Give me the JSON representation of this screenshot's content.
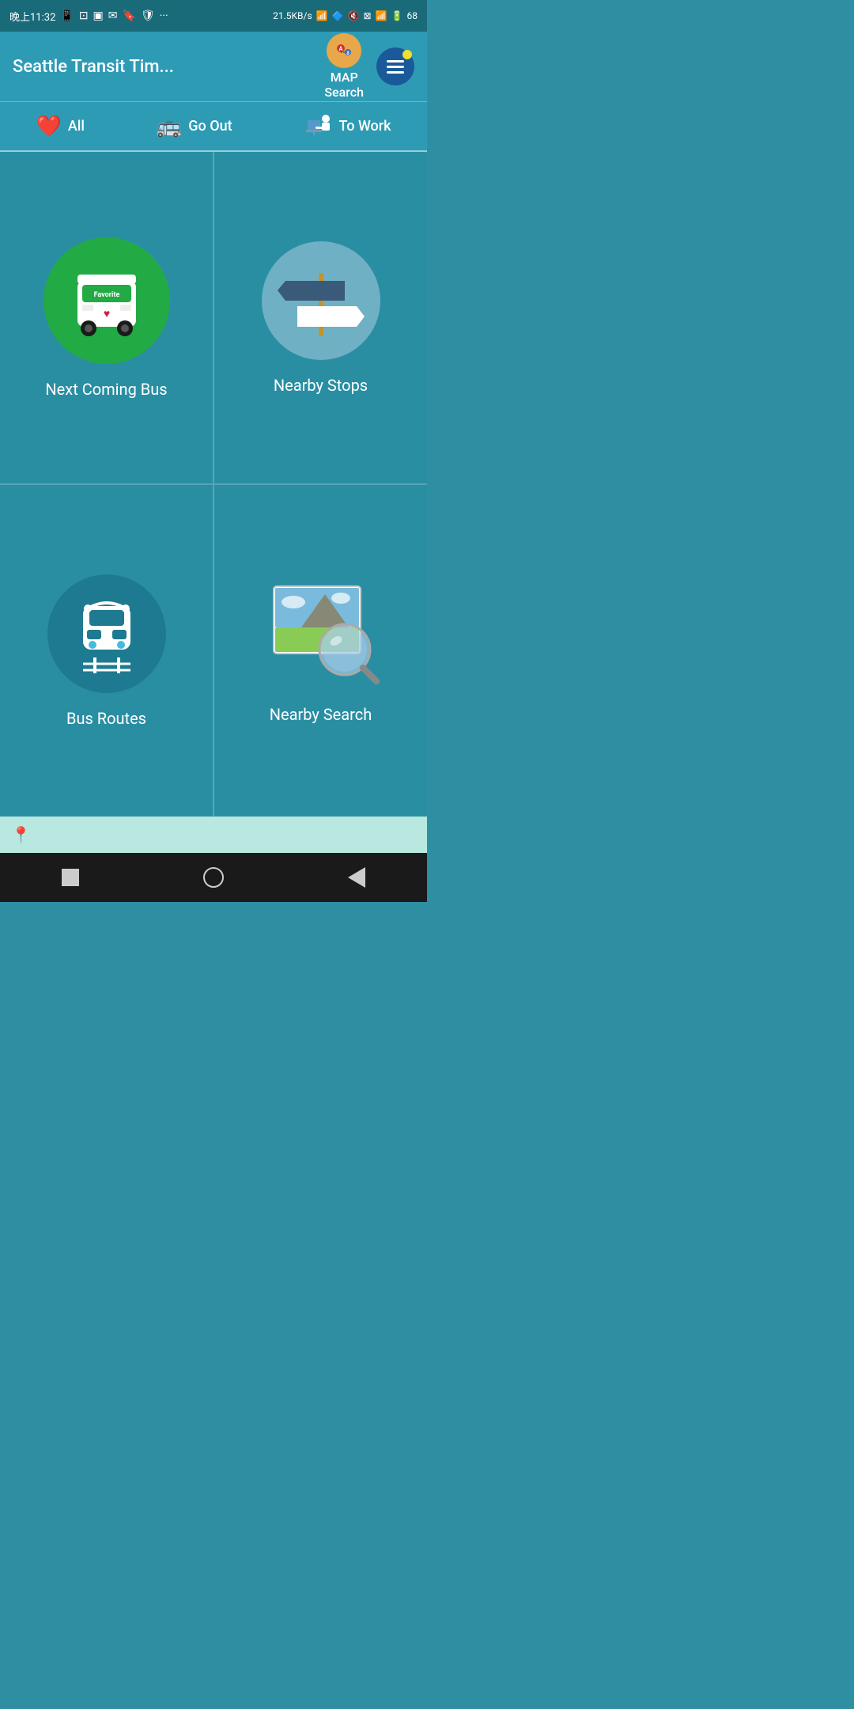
{
  "statusBar": {
    "time": "晚上11:32",
    "icons": [
      "📱",
      "⊡",
      "✉",
      "🔖",
      "🛡"
    ],
    "network": "21.5KB/s",
    "battery": "68",
    "wifiIcon": "wifi",
    "btIcon": "bt"
  },
  "header": {
    "title": "Seattle Transit Tim...",
    "mapSearch": "MAP\nSearch",
    "mapSearchLine1": "MAP",
    "mapSearchLine2": "Search"
  },
  "tabs": [
    {
      "id": "all",
      "emoji": "❤️",
      "label": "All"
    },
    {
      "id": "go-out",
      "emoji": "🚌",
      "label": "Go Out"
    },
    {
      "id": "to-work",
      "emoji": "🖥",
      "label": "To Work"
    }
  ],
  "grid": [
    {
      "id": "next-coming-bus",
      "label": "Next Coming Bus",
      "iconType": "bus"
    },
    {
      "id": "nearby-stops",
      "label": "Nearby Stops",
      "iconType": "signpost"
    },
    {
      "id": "bus-routes",
      "label": "Bus Routes",
      "iconType": "train"
    },
    {
      "id": "nearby-search",
      "label": "Nearby Search",
      "iconType": "magnifier"
    }
  ],
  "colors": {
    "background": "#2a8ea3",
    "headerBg": "#2e9bb5",
    "statusBg": "#1a6b7a",
    "busGreen": "#22aa44",
    "navBg": "#1a1a1a"
  }
}
